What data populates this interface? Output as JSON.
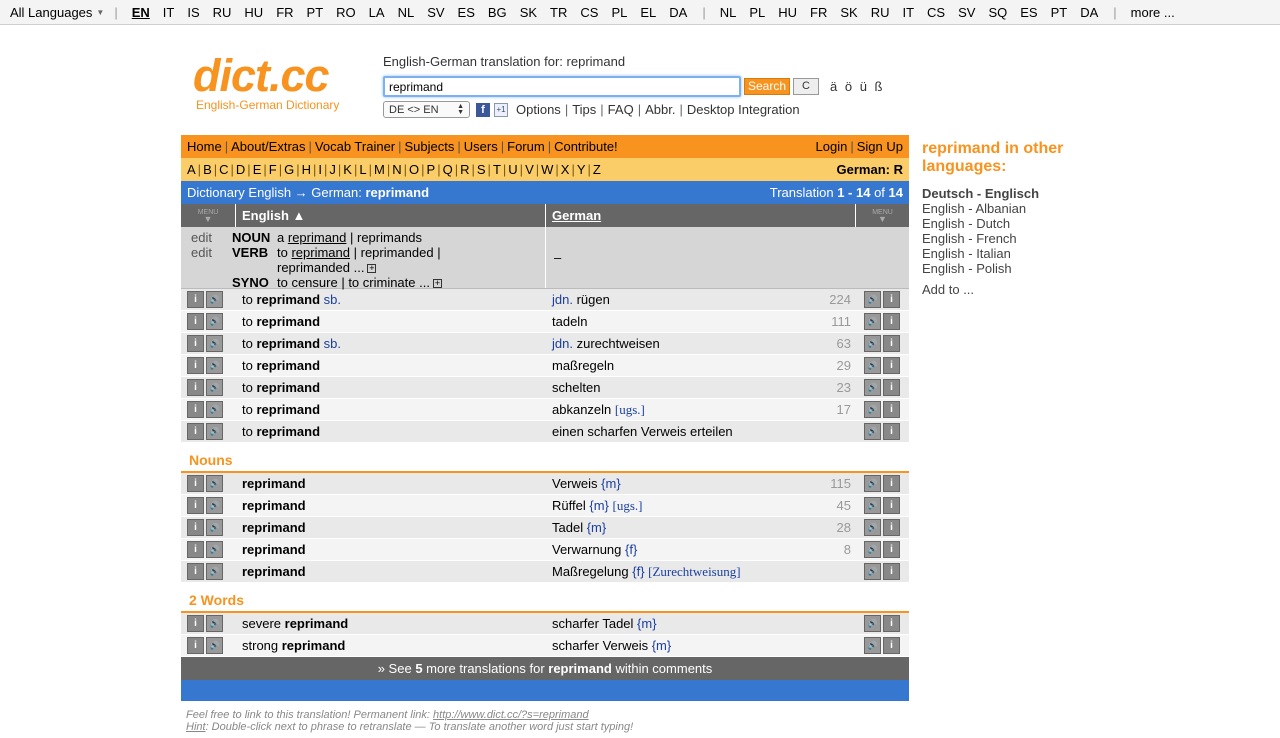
{
  "langbar": {
    "all_languages": "All Languages",
    "group1": [
      "EN",
      "IT",
      "IS",
      "RU",
      "HU",
      "FR",
      "PT",
      "RO",
      "LA",
      "NL",
      "SV",
      "ES",
      "BG",
      "SK",
      "TR",
      "CS",
      "PL",
      "EL",
      "DA"
    ],
    "group2": [
      "NL",
      "PL",
      "HU",
      "FR",
      "SK",
      "RU",
      "IT",
      "CS",
      "SV",
      "SQ",
      "ES",
      "PT",
      "DA"
    ],
    "more": "more ..."
  },
  "logo": {
    "brand": "dict.cc",
    "tagline": "English-German Dictionary"
  },
  "search": {
    "heading": "English-German translation for: reprimand",
    "value": "reprimand",
    "search_label": "Search",
    "clear_label": "C",
    "umlauts": "ä ö ü ß",
    "direction": "DE <> EN",
    "links": [
      "Options",
      "Tips",
      "FAQ",
      "Abbr.",
      "Desktop Integration"
    ]
  },
  "nav": {
    "items": [
      "Home",
      "About/Extras",
      "Vocab Trainer",
      "Subjects",
      "Users",
      "Forum",
      "Contribute!"
    ],
    "login": "Login",
    "signup": "Sign Up"
  },
  "alphabet": {
    "letters": [
      "A",
      "B",
      "C",
      "D",
      "E",
      "F",
      "G",
      "H",
      "I",
      "J",
      "K",
      "L",
      "M",
      "N",
      "O",
      "P",
      "Q",
      "R",
      "S",
      "T",
      "U",
      "V",
      "W",
      "X",
      "Y",
      "Z"
    ],
    "current": "German: R"
  },
  "bluebar": {
    "left_prefix": "Dictionary English → German: ",
    "left_term": "reprimand",
    "right_prefix": "Translation ",
    "right_range": "1 - 14",
    "right_of": " of ",
    "right_total": "14"
  },
  "columns": {
    "menu": "MENU",
    "english": "English ▲",
    "german": "German"
  },
  "grammar": {
    "edit": "edit",
    "noun_tag": "NOUN",
    "noun_a": "a",
    "noun_term": "reprimand",
    "noun_plural": "reprimands",
    "verb_tag": "VERB",
    "verb_to": "to",
    "verb_term": "reprimand",
    "verb_past": "reprimanded",
    "verb_more": "reprimanded ...",
    "syno_tag": "SYNO",
    "syno_1": "to censure",
    "syno_2": "to criminate ...",
    "german_side": "–"
  },
  "verbs": [
    {
      "pre": "to ",
      "term": "reprimand",
      "post": "sb.",
      "de_pre": "jdn.",
      "de": "rügen",
      "tag": "",
      "count": "224"
    },
    {
      "pre": "to ",
      "term": "reprimand",
      "post": "",
      "de_pre": "",
      "de": "tadeln",
      "tag": "",
      "count": "111"
    },
    {
      "pre": "to ",
      "term": "reprimand",
      "post": "sb.",
      "de_pre": "jdn.",
      "de": "zurechtweisen",
      "tag": "",
      "count": "63"
    },
    {
      "pre": "to ",
      "term": "reprimand",
      "post": "",
      "de_pre": "",
      "de": "maßregeln",
      "tag": "",
      "count": "29"
    },
    {
      "pre": "to ",
      "term": "reprimand",
      "post": "",
      "de_pre": "",
      "de": "schelten",
      "tag": "",
      "count": "23"
    },
    {
      "pre": "to ",
      "term": "reprimand",
      "post": "",
      "de_pre": "",
      "de": "abkanzeln",
      "tag": "[ugs.]",
      "count": "17"
    },
    {
      "pre": "to ",
      "term": "reprimand",
      "post": "",
      "de_pre": "",
      "de": "einen scharfen Verweis erteilen",
      "tag": "",
      "count": ""
    }
  ],
  "nouns_title": "Nouns",
  "nouns": [
    {
      "term": "reprimand",
      "de": "Verweis",
      "gender": "{m}",
      "tag": "",
      "count": "115"
    },
    {
      "term": "reprimand",
      "de": "Rüffel",
      "gender": "{m}",
      "tag": "[ugs.]",
      "count": "45"
    },
    {
      "term": "reprimand",
      "de": "Tadel",
      "gender": "{m}",
      "tag": "",
      "count": "28"
    },
    {
      "term": "reprimand",
      "de": "Verwarnung",
      "gender": "{f}",
      "tag": "",
      "count": "8"
    },
    {
      "term": "reprimand",
      "de": "Maßregelung",
      "gender": "{f}",
      "tag": "[Zurechtweisung]",
      "count": ""
    }
  ],
  "words_title": "2 Words",
  "words": [
    {
      "pre": "severe ",
      "term": "reprimand",
      "de": "scharfer Tadel",
      "gender": "{m}"
    },
    {
      "pre": "strong ",
      "term": "reprimand",
      "de": "scharfer Verweis",
      "gender": "{m}"
    }
  ],
  "morebar": {
    "pre": "» See ",
    "count": "5",
    "mid": " more translations for ",
    "term": "reprimand",
    "post": " within comments"
  },
  "footnote": {
    "line1_pre": "Feel free to link to this translation! Permanent link: ",
    "line1_link": "http://www.dict.cc/?s=reprimand",
    "line2_hint": "Hint",
    "line2": ": Double-click next to phrase to retranslate — To translate another word just start typing!"
  },
  "sidebar": {
    "title": "reprimand in other languages:",
    "items": [
      "Deutsch - Englisch",
      "English - Albanian",
      "English - Dutch",
      "English - French",
      "English - Italian",
      "English - Polish"
    ],
    "add": "Add to ..."
  }
}
